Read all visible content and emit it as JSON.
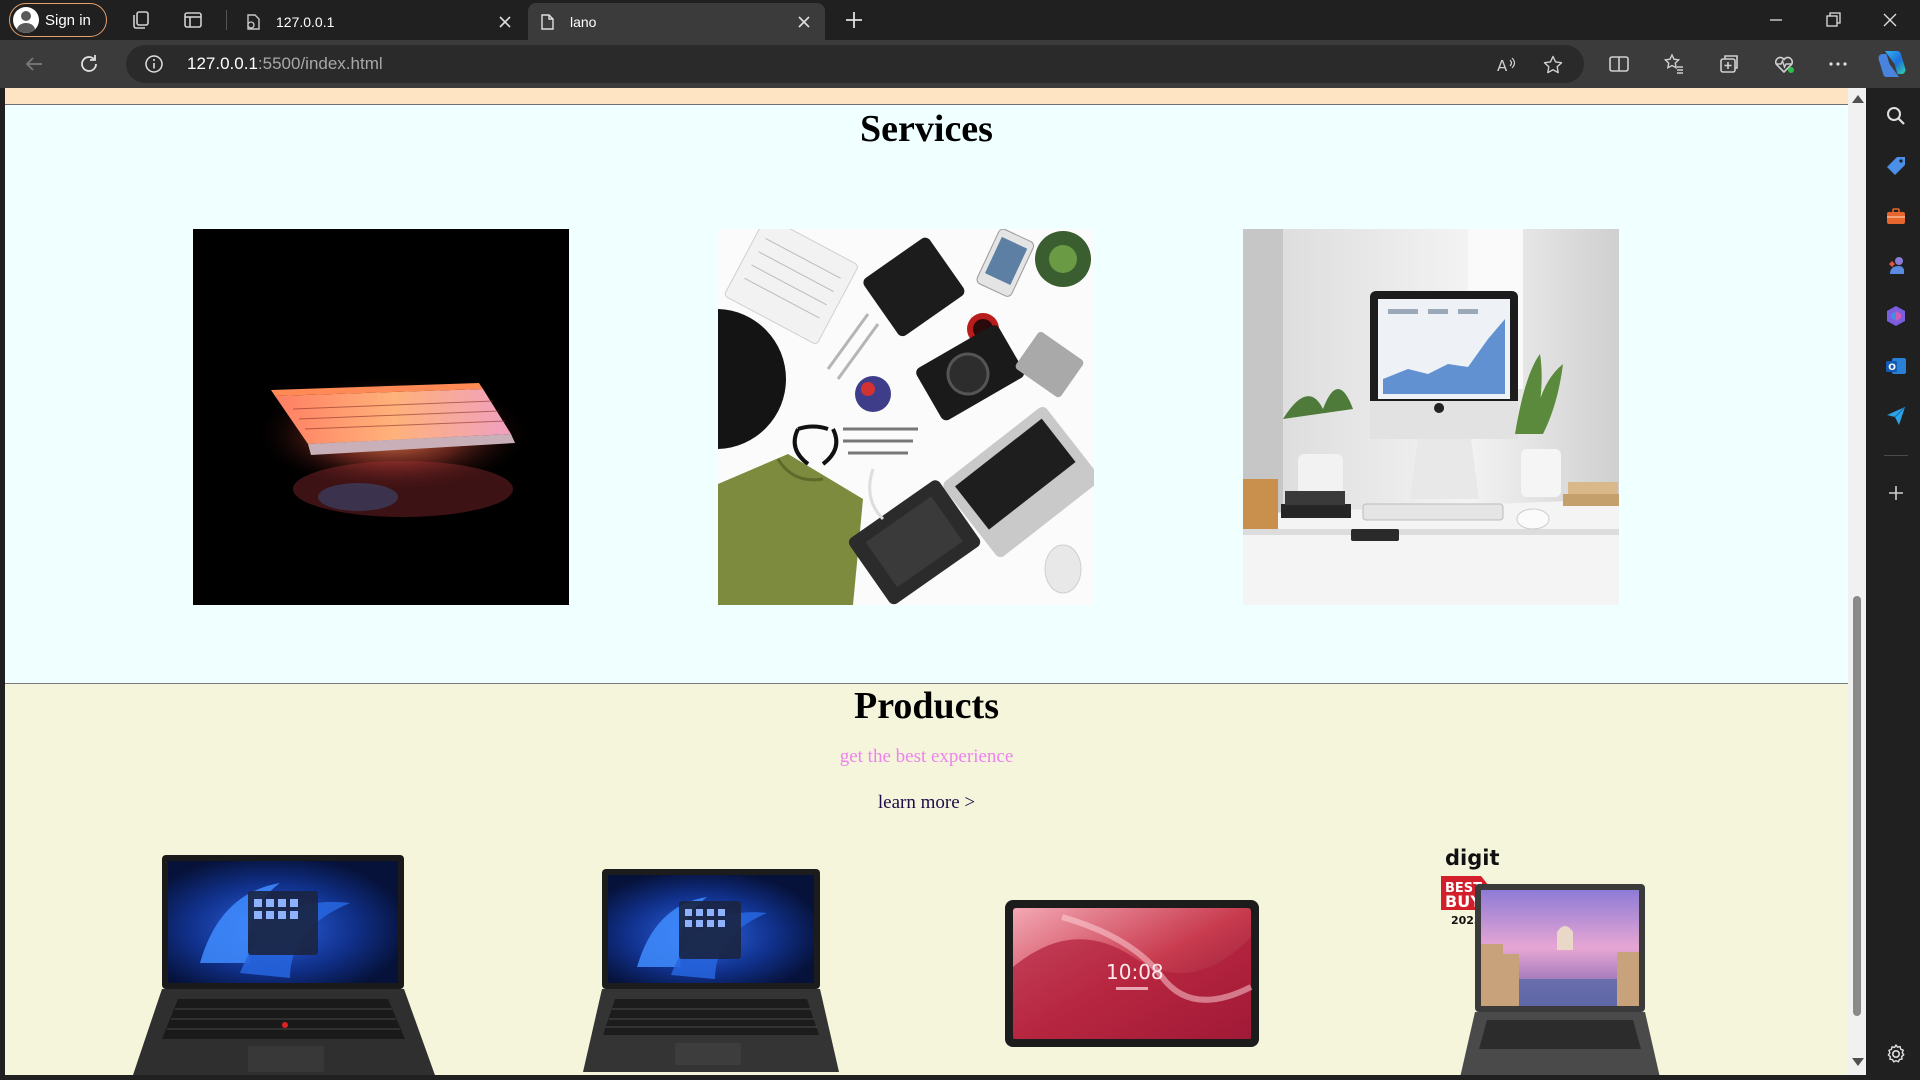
{
  "browser": {
    "profile_label": "Sign in",
    "tabs": [
      {
        "title": "127.0.0.1",
        "active": false
      },
      {
        "title": "lano",
        "active": true
      }
    ],
    "url_host": "127.0.0.1",
    "url_rest": ":5500/index.html",
    "accent_color": "#e6a06c"
  },
  "page": {
    "services": {
      "title": "Services",
      "background": "#f0ffff",
      "images": [
        {
          "name": "glowing-laptop-image"
        },
        {
          "name": "flatlay-gadgets-image"
        },
        {
          "name": "desk-computer-image"
        }
      ]
    },
    "products": {
      "title": "Products",
      "tagline": "get the best experience",
      "link_label": "learn more >",
      "background": "#f5f5dc",
      "badge_brand": "digit",
      "badge_best": "BEST",
      "badge_buy": "BUY",
      "badge_year": "2023",
      "tablet_clock": "10:08"
    }
  }
}
